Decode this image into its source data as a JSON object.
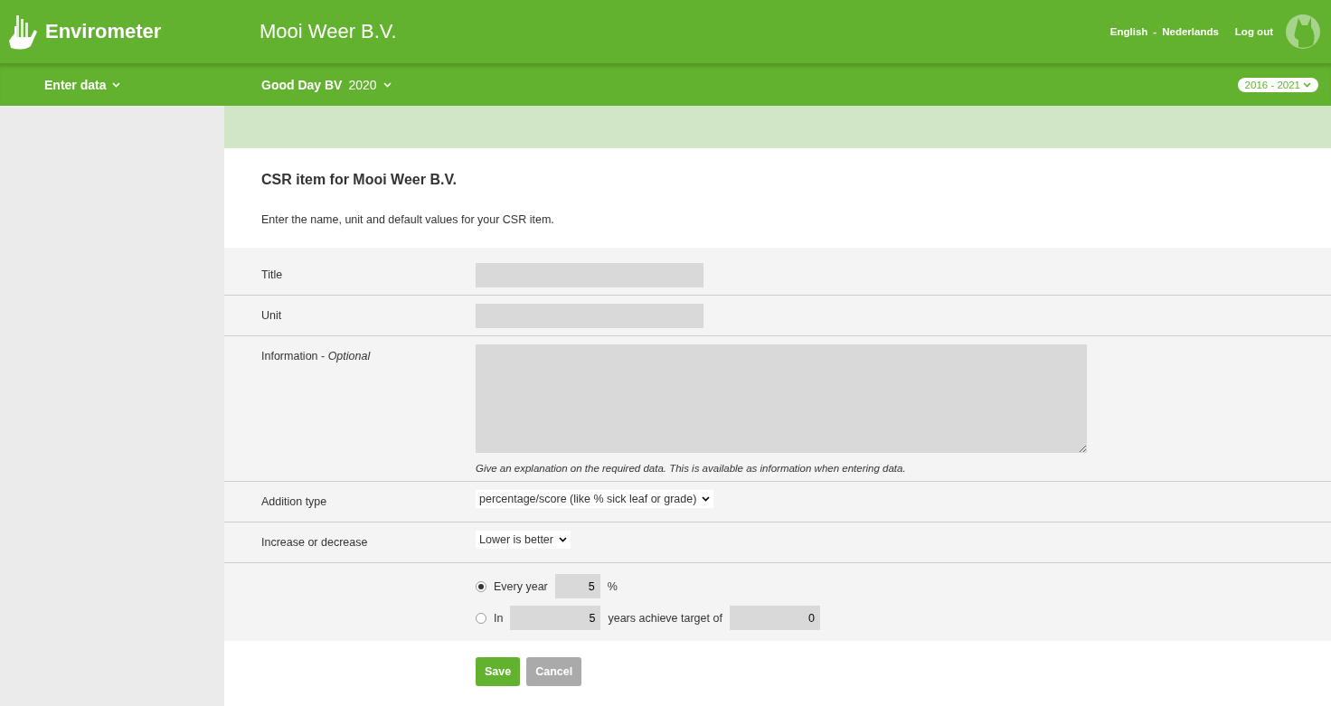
{
  "header": {
    "app_name": "Envirometer",
    "company": "Mooi Weer B.V.",
    "languages": [
      "English",
      "Nederlands"
    ],
    "separator": "-",
    "logout": "Log out"
  },
  "subbar": {
    "menu": "Enter data",
    "organisation": "Good Day BV",
    "year": "2020",
    "period": "2016 - 2021"
  },
  "page": {
    "title": "CSR item for Mooi Weer B.V.",
    "intro": "Enter the name, unit and default values for your CSR item."
  },
  "fields": [
    {
      "kind": "text",
      "label": "Title"
    },
    {
      "kind": "text",
      "label": "Unit"
    },
    {
      "kind": "textarea",
      "label": "Information - *Optional*",
      "help": "Give an explanation on the required data. This is available as information when entering data."
    },
    {
      "kind": "select",
      "label": "Addition type",
      "value": "percentage/score (like % sick leaf or grade)"
    },
    {
      "kind": "select",
      "label": "Increase or decrease",
      "value": "Lower is better"
    },
    {
      "kind": "radios",
      "options": [
        {
          "selected": true,
          "label": "Every year",
          "value": "5",
          "suffix": "%"
        },
        {
          "selected": false,
          "label": "In",
          "value": "5",
          "suffix": "years achieve target of",
          "target": "0"
        }
      ]
    }
  ],
  "buttons": [
    {
      "kind": "primary",
      "label": "Save"
    },
    {
      "kind": "secondary",
      "label": "Cancel"
    }
  ]
}
